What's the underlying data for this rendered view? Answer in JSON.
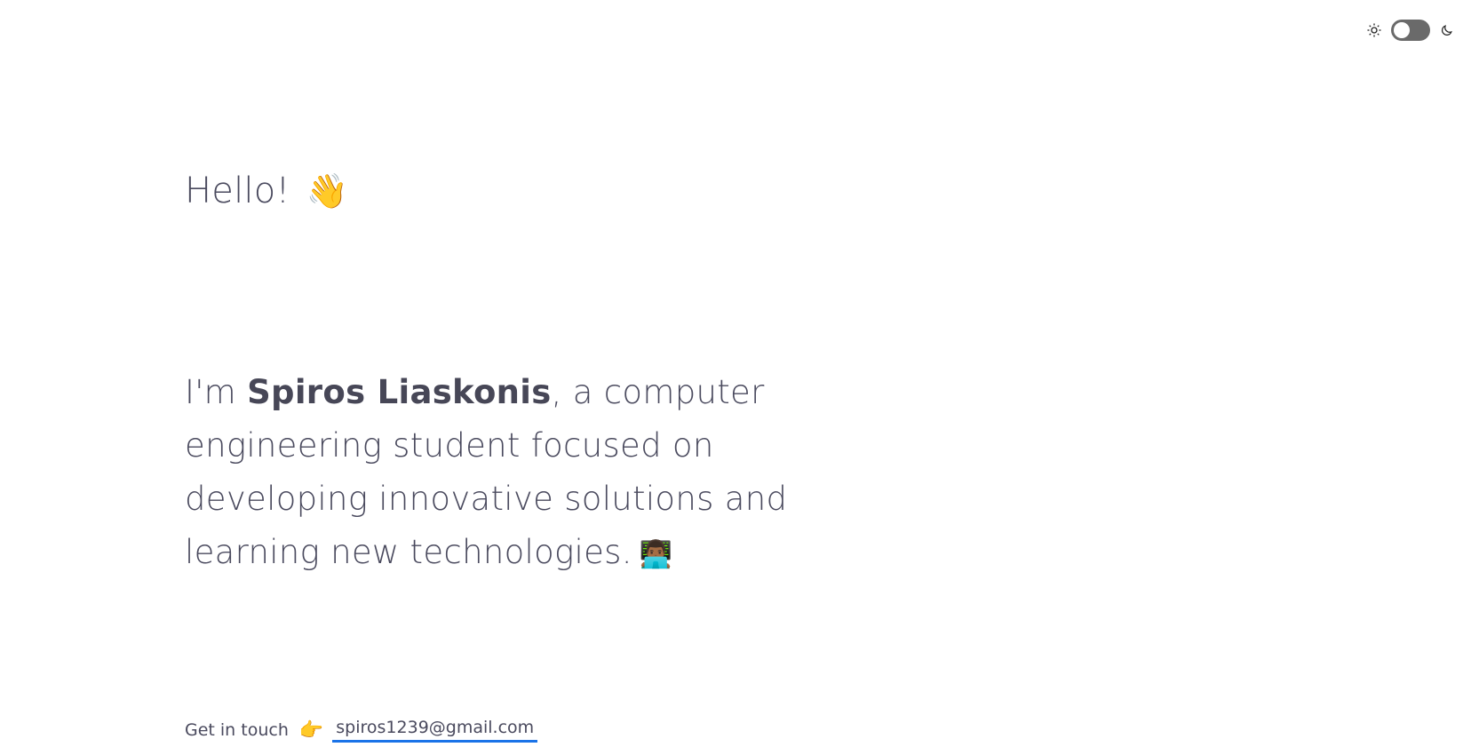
{
  "theme_toggle": {
    "sun_icon": "sun-icon",
    "moon_icon": "moon-icon",
    "dark_mode": false
  },
  "hero": {
    "greeting": "Hello!",
    "greeting_emoji": "👋"
  },
  "intro": {
    "prefix": "I'm ",
    "name": "Spiros Liaskonis",
    "description": ", a computer engineering student focused on developing innovative solutions and learning new technologies.",
    "emoji": "👨🏾‍💻"
  },
  "contact": {
    "label": "Get in touch",
    "pointer_emoji": "👉",
    "email": "spiros1239@gmail.com"
  },
  "colors": {
    "text": "#4a4a5e",
    "link_underline": "#1a73e8",
    "toggle_track": "#6a6a6a"
  }
}
